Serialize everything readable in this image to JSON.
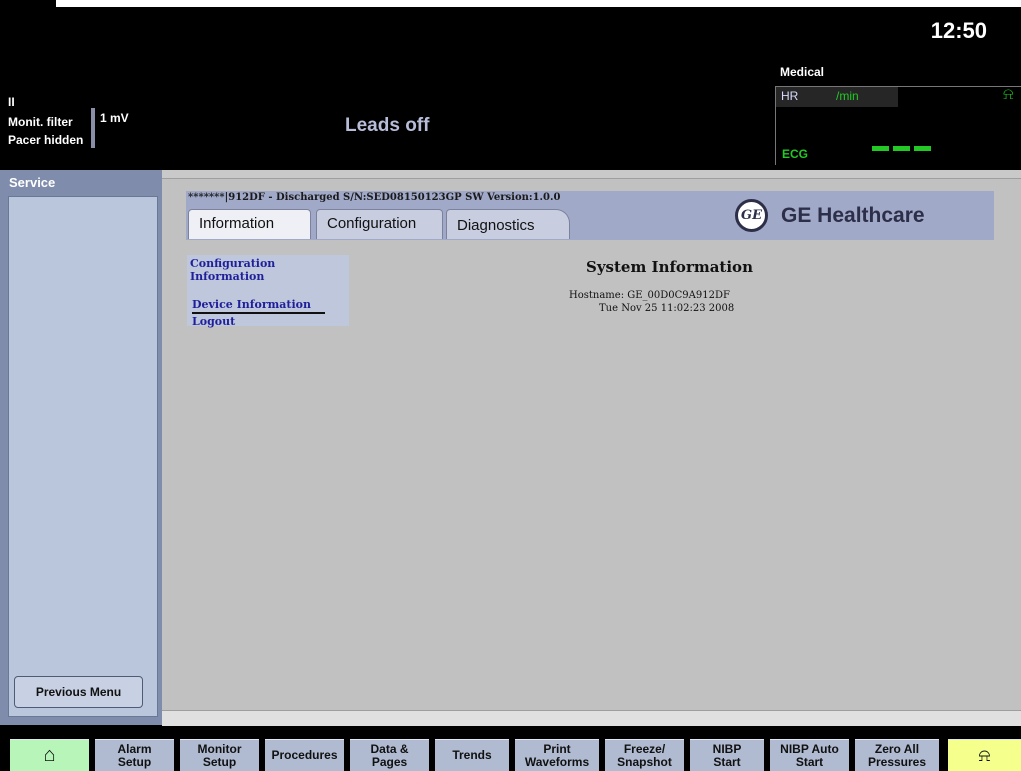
{
  "header": {
    "clock": "12:50",
    "lead": "II",
    "monit_filter": "Monit. filter",
    "pacer": "Pacer hidden",
    "scale": "1 mV",
    "status": "Leads off",
    "care_unit": "Medical",
    "hr_label": "HR",
    "hr_unit": "/min",
    "ecg_label": "ECG",
    "hr_value_display": "---"
  },
  "service_panel": {
    "title": "Service",
    "previous_menu": "Previous Menu"
  },
  "web": {
    "status_line": "*******|912DF - Discharged   S/N:SED08150123GP   SW Version:1.0.0",
    "tabs": [
      "Information",
      "Configuration",
      "Diagnostics"
    ],
    "active_tab": "Information",
    "brand_mark": "GE",
    "brand": "GE Healthcare",
    "menu": {
      "config_line1": "Configuration",
      "config_line2": "Information",
      "device_info": "Device Information",
      "logout": "Logout"
    },
    "system_info": {
      "title": "System Information",
      "hostname": "Hostname: GE_00D0C9A912DF",
      "datetime": "Tue Nov 25 11:02:23 2008"
    }
  },
  "toolbar": {
    "home_icon": "⌂",
    "alarm_setup": "Alarm\nSetup",
    "monitor_setup": "Monitor\nSetup",
    "procedures": "Procedures",
    "data_pages": "Data &\nPages",
    "trends": "Trends",
    "print_waveforms": "Print\nWaveforms",
    "freeze_snapshot": "Freeze/\nSnapshot",
    "nibp_start": "NIBP\nStart",
    "nibp_auto_start": "NIBP Auto\nStart",
    "zero_all_pressures": "Zero All\nPressures",
    "silence_icon": "⍾"
  },
  "colors": {
    "ecg_green": "#22c924",
    "panel_blue": "#b9c6dc",
    "home_green": "#b7f5b8",
    "silence_yellow": "#f5ff8c"
  }
}
